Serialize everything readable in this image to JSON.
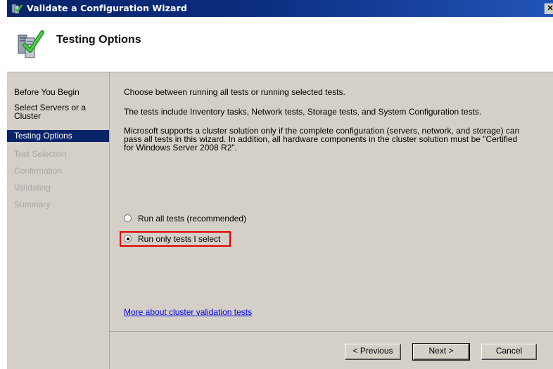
{
  "window": {
    "title": "Validate a Configuration Wizard",
    "close_label": "✕"
  },
  "header": {
    "title": "Testing Options"
  },
  "nav": {
    "items": [
      {
        "label": "Before You Begin",
        "state": "normal"
      },
      {
        "label": "Select Servers or a Cluster",
        "state": "normal"
      },
      {
        "label": "Testing Options",
        "state": "current"
      },
      {
        "label": "Test Selection",
        "state": "disabled"
      },
      {
        "label": "Confirmation",
        "state": "disabled"
      },
      {
        "label": "Validating",
        "state": "disabled"
      },
      {
        "label": "Summary",
        "state": "disabled"
      }
    ]
  },
  "content": {
    "intro": "Choose between running all tests or running selected tests.",
    "tests_info": "The tests include Inventory tasks, Network tests, Storage tests, and System Configuration tests.",
    "support_line1": "Microsoft supports a cluster solution only if the complete configuration (servers, network, and storage) can",
    "support_line2": "pass all tests in this wizard. In addition, all hardware components in the cluster solution must be \"Certified",
    "support_line3": "for Windows Server 2008 R2\".",
    "options": [
      {
        "label": "Run all tests (recommended)",
        "selected": false
      },
      {
        "label": "Run only tests I select",
        "selected": true
      }
    ],
    "link": "More about cluster validation tests"
  },
  "buttons": {
    "previous": "< Previous",
    "next": "Next >",
    "cancel": "Cancel"
  },
  "colors": {
    "highlight_box": "#e00000",
    "title_bar": "#0a246a",
    "nav_current": "#0a246a",
    "disabled_text": "#a6a6a6"
  }
}
